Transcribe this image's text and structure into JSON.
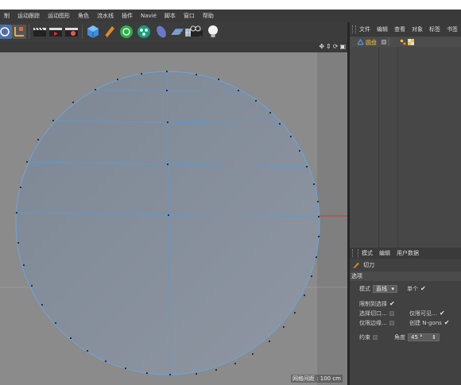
{
  "menu": [
    "制",
    "运动跟踪",
    "运动图形",
    "角色",
    "流水线",
    "插件",
    "Navié",
    "脚本",
    "窗口",
    "帮助"
  ],
  "viewport": {
    "grid_info": "网格间距 : 100 cm",
    "nav_icons": [
      "move-icon",
      "zoom-icon",
      "rotate-icon",
      "maximize-icon"
    ]
  },
  "object_manager": {
    "menu": [
      "文件",
      "编辑",
      "查看",
      "对象",
      "标签",
      "书签"
    ],
    "object_name": "圆盘"
  },
  "attribute_manager": {
    "menu": [
      "模式",
      "编辑",
      "用户数据"
    ],
    "tool_name": "切刀",
    "section": "选项",
    "mode_label": "模式",
    "mode_value": "直线",
    "single_label": "单个",
    "restrict_label": "限制到选择",
    "select_cut_label": "选择切口…",
    "visible_only_label": "仅限可见…",
    "edges_only_label": "仅限边缘…",
    "create_ngons_label": "创建 N-gons",
    "constrain_label": "约束",
    "angle_label": "角度",
    "angle_value": "45 °"
  },
  "colors": {
    "accent_blue": "#5b9bd5",
    "axis_green": "#3fbf3f",
    "axis_red": "#c83c3c",
    "object_name": "#f0c040"
  }
}
